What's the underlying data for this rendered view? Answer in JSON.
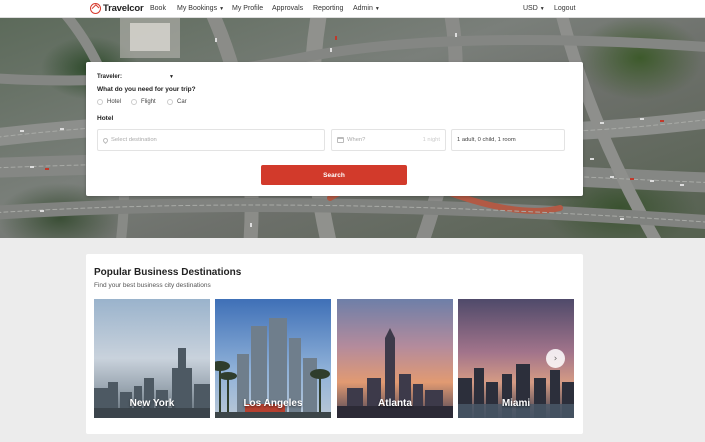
{
  "nav": {
    "brand": "Travelcor",
    "items": [
      {
        "label": "Book",
        "dropdown": false
      },
      {
        "label": "My Bookings",
        "dropdown": true
      },
      {
        "label": "My Profile",
        "dropdown": false
      },
      {
        "label": "Approvals",
        "dropdown": false
      },
      {
        "label": "Reporting",
        "dropdown": false
      },
      {
        "label": "Admin",
        "dropdown": true
      }
    ],
    "currency": "USD",
    "logout": "Logout"
  },
  "search": {
    "traveler_label": "Traveler:",
    "question": "What do you need for your trip?",
    "options": [
      "Hotel",
      "Flight",
      "Car"
    ],
    "section_title": "Hotel",
    "destination_placeholder": "Select destination",
    "dates_placeholder": "When?",
    "nights": "1 night",
    "guests": "1 adult, 0 child, 1 room",
    "button": "Search"
  },
  "destinations": {
    "title": "Popular Business Destinations",
    "subtitle": "Find your best business city destinations",
    "cities": [
      "New York",
      "Los Angeles",
      "Atlanta",
      "Miami"
    ]
  },
  "colors": {
    "accent": "#d23a2b",
    "brand_icon": "#d63b2e"
  }
}
